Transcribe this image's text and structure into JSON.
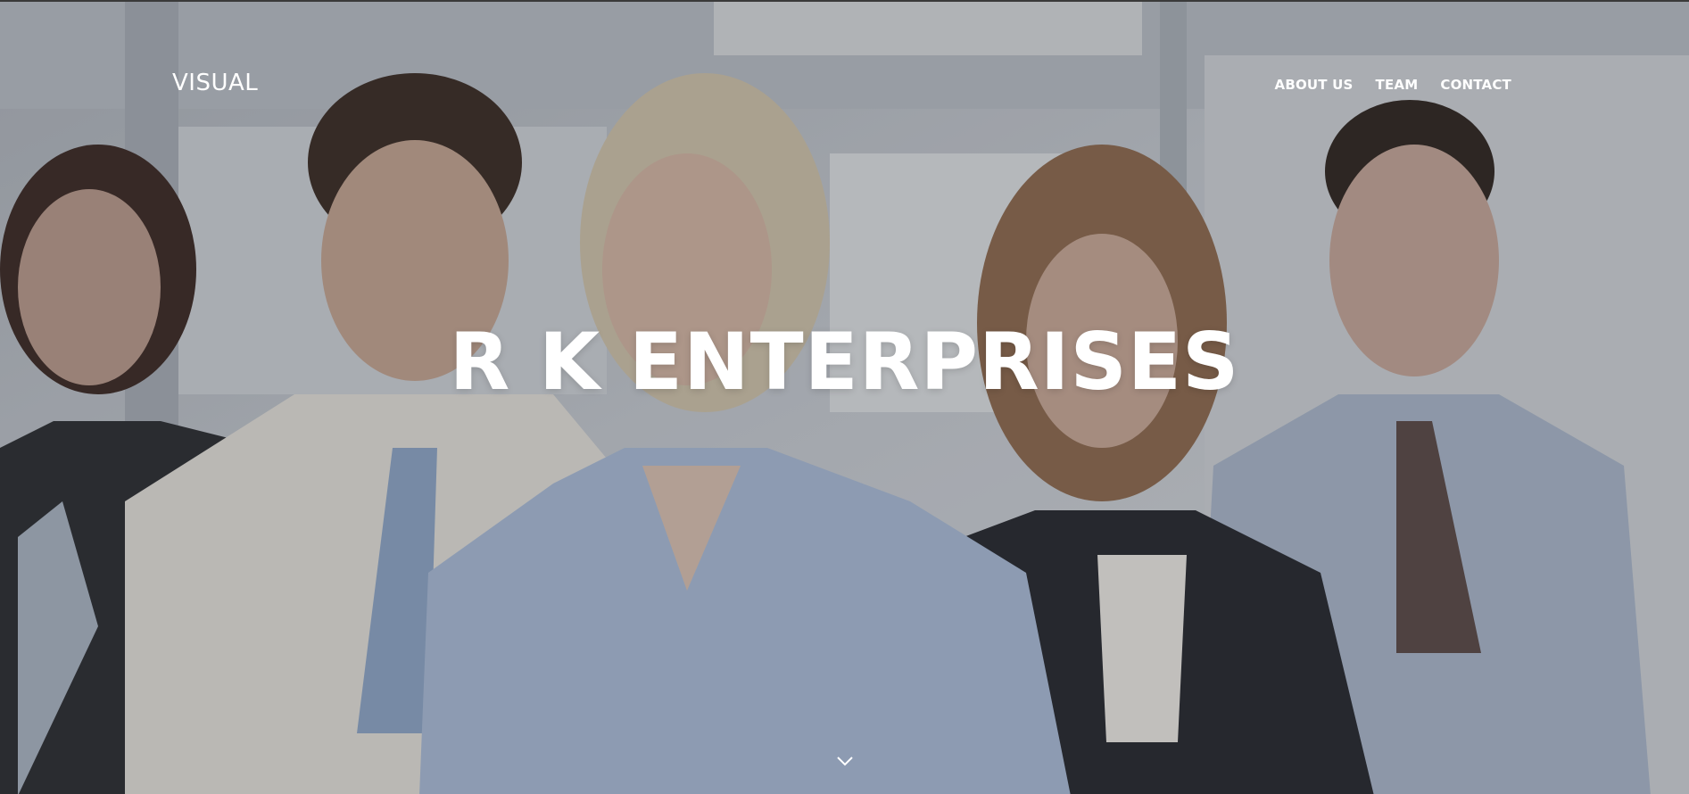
{
  "nav": {
    "brand": "VISUAL",
    "links": [
      {
        "label": "ABOUT US"
      },
      {
        "label": "TEAM"
      },
      {
        "label": "CONTACT"
      }
    ]
  },
  "hero": {
    "title": "R K ENTERPRISES",
    "scroll_icon": "chevron-down-icon"
  },
  "colors": {
    "text": "#ffffff",
    "shirt_blue": "#a9bcd9",
    "suit_dark": "#2a2c33",
    "background": "#c9ced6"
  }
}
